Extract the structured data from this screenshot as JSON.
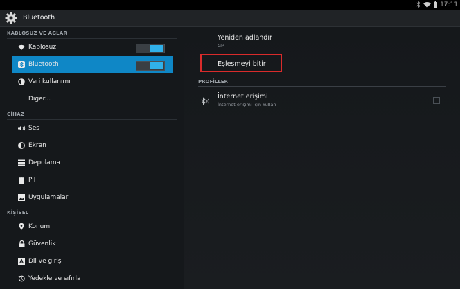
{
  "status": {
    "time": "17:11",
    "icons": [
      "bluetooth-icon",
      "wifi-icon",
      "battery-icon"
    ]
  },
  "header": {
    "title": "Bluetooth",
    "icon": "settings-gear-icon"
  },
  "sidebar": {
    "sections": [
      {
        "title": "KABLOSUZ VE AĞLAR",
        "items": [
          {
            "label": "Kablosuz",
            "icon": "wifi-icon",
            "toggle": true
          },
          {
            "label": "Bluetooth",
            "icon": "bluetooth-icon",
            "toggle": true,
            "selected": true
          },
          {
            "label": "Veri kullanımı",
            "icon": "data-usage-icon"
          },
          {
            "label": "Diğer...",
            "icon": ""
          }
        ]
      },
      {
        "title": "CİHAZ",
        "items": [
          {
            "label": "Ses",
            "icon": "sound-icon"
          },
          {
            "label": "Ekran",
            "icon": "display-icon"
          },
          {
            "label": "Depolama",
            "icon": "storage-icon"
          },
          {
            "label": "Pil",
            "icon": "battery-icon"
          },
          {
            "label": "Uygulamalar",
            "icon": "apps-icon"
          }
        ]
      },
      {
        "title": "KİŞİSEL",
        "items": [
          {
            "label": "Konum",
            "icon": "location-icon"
          },
          {
            "label": "Güvenlik",
            "icon": "lock-icon"
          },
          {
            "label": "Dil ve giriş",
            "icon": "keyboard-icon"
          },
          {
            "label": "Yedekle ve sıfırla",
            "icon": "backup-icon"
          }
        ]
      }
    ]
  },
  "main": {
    "rename": {
      "title": "Yeniden adlandır",
      "subtitle": "GM"
    },
    "unpair": {
      "title": "Eşleşmeyi bitir"
    },
    "profiles_header": "PROFİLLER",
    "internet": {
      "title": "İnternet erişimi",
      "subtitle": "İnternet erişimi için kullan",
      "checked": false
    }
  },
  "colors": {
    "accent": "#0f87c6",
    "highlight": "#d92b2b",
    "toggle_on": "#30b1ea"
  }
}
